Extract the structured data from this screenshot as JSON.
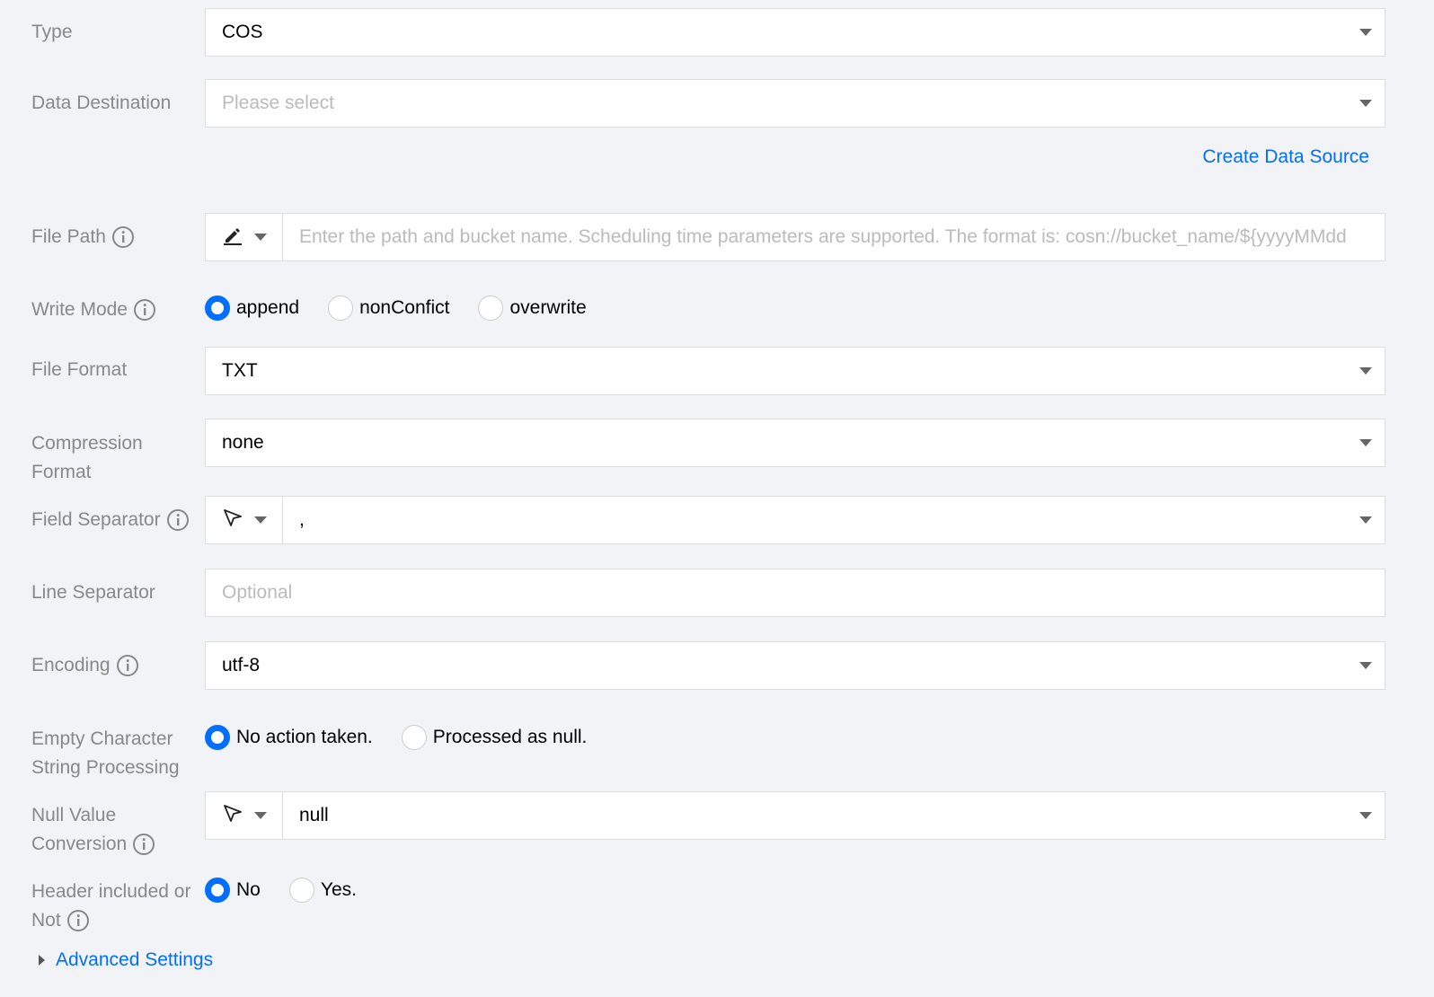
{
  "type": {
    "label": "Type",
    "value": "COS"
  },
  "data_destination": {
    "label": "Data Destination",
    "placeholder": "Please select"
  },
  "create_data_source": "Create Data Source",
  "file_path": {
    "label": "File Path",
    "placeholder": "Enter the path and bucket name. Scheduling time parameters are supported. The format is: cosn://bucket_name/${yyyyMMdd"
  },
  "write_mode": {
    "label": "Write Mode",
    "options": [
      "append",
      "nonConfict",
      "overwrite"
    ],
    "selected": "append"
  },
  "file_format": {
    "label": "File Format",
    "value": "TXT"
  },
  "compression_format": {
    "label_line1": "Compression",
    "label_line2": "Format",
    "value": "none"
  },
  "field_separator": {
    "label": "Field Separator",
    "value": ","
  },
  "line_separator": {
    "label": "Line Separator",
    "placeholder": "Optional"
  },
  "encoding": {
    "label": "Encoding",
    "value": "utf-8"
  },
  "empty_string": {
    "label_line1": "Empty Character",
    "label_line2": "String Processing",
    "options": [
      "No action taken.",
      "Processed as null."
    ],
    "selected": "No action taken."
  },
  "null_value": {
    "label_line1": "Null Value",
    "label_line2": "Conversion",
    "value": "null"
  },
  "header": {
    "label_line1": "Header included or",
    "label_line2": "Not",
    "options": [
      "No",
      "Yes."
    ],
    "selected": "No"
  },
  "advanced_settings": "Advanced Settings",
  "colors": {
    "accent": "#006eff",
    "label": "#888888",
    "background": "#f2f3f6"
  }
}
